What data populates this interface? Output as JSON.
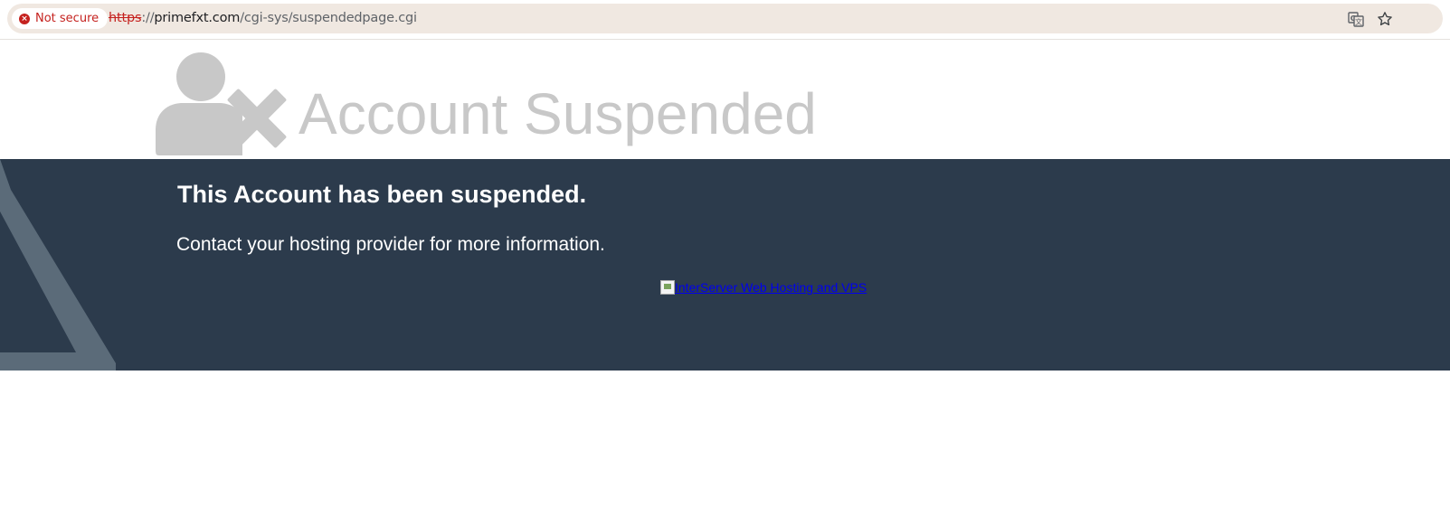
{
  "browser": {
    "security_chip": "Not secure",
    "url_scheme": "https",
    "url_sep": "://",
    "url_host": "primefxt.com",
    "url_path": "/cgi-sys/suspendedpage.cgi",
    "icons": [
      "error-icon",
      "translate-icon",
      "star-icon"
    ]
  },
  "page": {
    "heading": "Account Suspended",
    "message_title": "This Account has been suspended.",
    "message_subtitle": "Contact your hosting provider for more information.",
    "banner_alt": "InterServer Web Hosting and VPS"
  },
  "colors": {
    "band": "#2c3b4c",
    "heading": "#c8c8c8",
    "deco": "#5b6b79",
    "link": "#0000ee",
    "insecure": "#c5221f"
  }
}
